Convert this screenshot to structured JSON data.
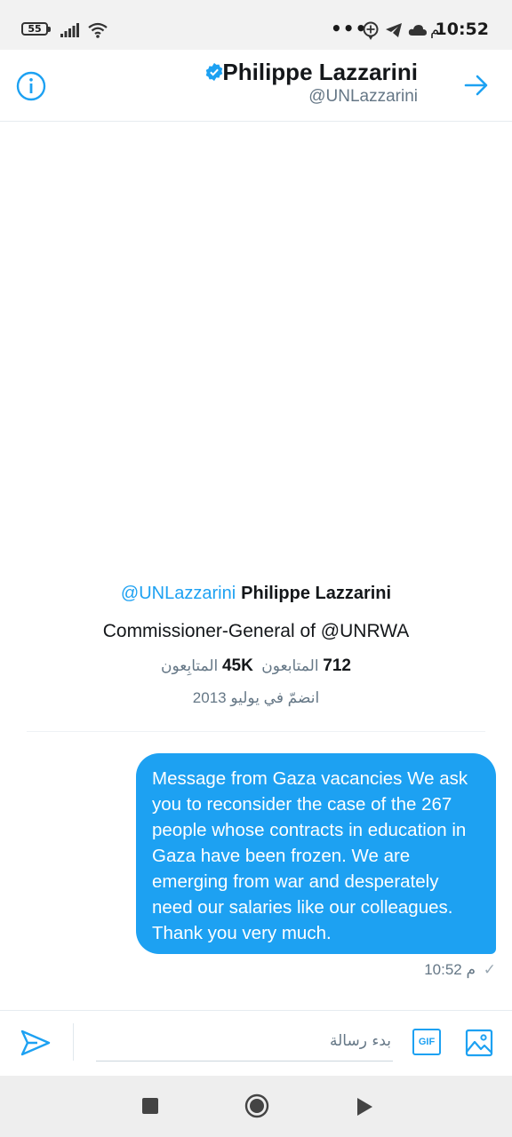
{
  "status_bar": {
    "battery": "55",
    "overflow": "•••",
    "ampm": "م",
    "time": "10:52",
    "icons": [
      "battery-icon",
      "signal-icon",
      "wifi-icon",
      "location-icon",
      "telegram-icon",
      "cloud-icon"
    ]
  },
  "header": {
    "name": "Philippe Lazzarini",
    "handle": "@UNLazzarini",
    "icons": [
      "info-icon",
      "verified-badge-icon",
      "arrow-right-icon"
    ]
  },
  "profile": {
    "handle": "@UNLazzarini",
    "name": "Philippe Lazzarini",
    "bio": "Commissioner-General of @UNRWA",
    "following_count": "712",
    "following_label": "المتابعون",
    "followers_count": "45K",
    "followers_label": "المتابِعون",
    "joined": "انضمّ في يوليو 2013"
  },
  "message": {
    "text": "Message from Gaza vacancies We ask you to reconsider the case of the 267 people whose contracts in education in Gaza have been frozen. We are emerging from war and desperately need our salaries like our colleagues. Thank you very much.",
    "time": "10:52",
    "ampm": "م",
    "status": "✓"
  },
  "composer": {
    "placeholder": "بدء رسالة",
    "value": "",
    "gif_label": "GIF",
    "icons": [
      "send-icon",
      "gif-icon",
      "image-icon"
    ]
  },
  "nav": {
    "icons": [
      "recents-icon",
      "home-icon",
      "back-icon"
    ]
  },
  "colors": {
    "accent": "#1da1f2",
    "text": "#14171a",
    "secondary": "#657786",
    "status_bar_bg": "#f2f2f2",
    "nav_bg": "#eeeeee"
  }
}
